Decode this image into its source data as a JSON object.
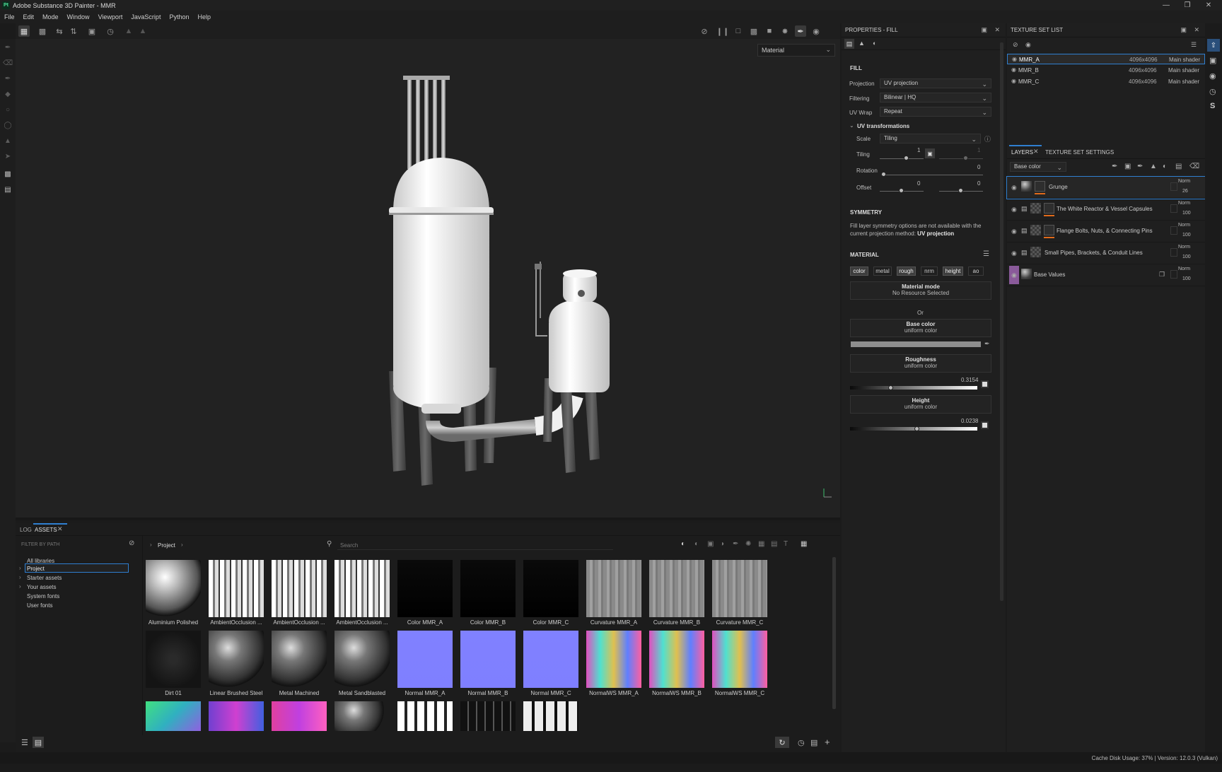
{
  "app": {
    "logo": "Pt",
    "title": "Adobe Substance 3D Painter - MMR",
    "window_controls": [
      "minimize-icon",
      "restore-icon",
      "close-icon"
    ]
  },
  "menu": [
    "File",
    "Edit",
    "Mode",
    "Window",
    "Viewport",
    "JavaScript",
    "Python",
    "Help"
  ],
  "viewport": {
    "mode_select": "Material"
  },
  "properties": {
    "header": "PROPERTIES - FILL",
    "fill_section": "FILL",
    "projection_label": "Projection",
    "projection_value": "UV projection",
    "filtering_label": "Filtering",
    "filtering_value": "Bilinear | HQ",
    "uvwrap_label": "UV Wrap",
    "uvwrap_value": "Repeat",
    "uvtransform_label": "UV transformations",
    "scale_label": "Scale",
    "scale_value": "Tiling",
    "tiling_label": "Tiling",
    "tiling_value": "1",
    "tiling_value2": "1",
    "rotation_label": "Rotation",
    "rotation_value": "0",
    "offset_label": "Offset",
    "offset_value_u": "0",
    "offset_value_v": "0",
    "symmetry_title": "SYMMETRY",
    "symmetry_text": "Fill layer symmetry options are not available with the current projection method:",
    "symmetry_method": "UV projection",
    "material_title": "MATERIAL",
    "channels": [
      {
        "label": "color",
        "on": true
      },
      {
        "label": "metal",
        "on": false
      },
      {
        "label": "rough",
        "on": true
      },
      {
        "label": "nrm",
        "on": false
      },
      {
        "label": "height",
        "on": true
      },
      {
        "label": "ao",
        "on": false
      }
    ],
    "material_mode_title": "Material mode",
    "material_mode_value": "No Resource Selected",
    "or_label": "Or",
    "base_color_title": "Base color",
    "base_color_sub": "uniform color",
    "roughness_title": "Roughness",
    "roughness_sub": "uniform color",
    "roughness_value": "0.3154",
    "height_title": "Height",
    "height_sub": "uniform color",
    "height_value": "0.0238"
  },
  "texture_set_list": {
    "header": "TEXTURE SET LIST",
    "rows": [
      {
        "name": "MMR_A",
        "res": "4096x4096",
        "shader": "Main shader",
        "selected": true
      },
      {
        "name": "MMR_B",
        "res": "4096x4096",
        "shader": "Main shader",
        "selected": false
      },
      {
        "name": "MMR_C",
        "res": "4096x4096",
        "shader": "Main shader",
        "selected": false
      }
    ]
  },
  "layers": {
    "tab_layers": "LAYERS",
    "tab_settings": "TEXTURE SET SETTINGS",
    "channel_select": "Base color",
    "items": [
      {
        "name": "Grunge",
        "blend": "Norm",
        "opacity": "26",
        "selected": true,
        "folder": false
      },
      {
        "name": "The White Reactor & Vessel Capsules",
        "blend": "Norm",
        "opacity": "100",
        "selected": false,
        "folder": true
      },
      {
        "name": "Flange Bolts, Nuts, & Connecting Pins",
        "blend": "Norm",
        "opacity": "100",
        "selected": false,
        "folder": true
      },
      {
        "name": "Small Pipes, Brackets, & Conduit Lines",
        "blend": "Norm",
        "opacity": "100",
        "selected": false,
        "folder": true
      },
      {
        "name": "Base Values",
        "blend": "Norm",
        "opacity": "100",
        "selected": false,
        "folder": false
      }
    ]
  },
  "assets": {
    "tab_log": "LOG",
    "tab_assets": "ASSETS",
    "filter_placeholder": "FILTER BY PATH",
    "breadcrumb": "Project",
    "search_placeholder": "Search",
    "tree": [
      "All libraries",
      "Project",
      "Starter assets",
      "Your assets",
      "System fonts",
      "User fonts"
    ],
    "items": [
      {
        "name": "Aluminium Polished",
        "kind": "sphere-light"
      },
      {
        "name": "AmbientOcclusion ...",
        "kind": "ao"
      },
      {
        "name": "AmbientOcclusion ...",
        "kind": "ao"
      },
      {
        "name": "AmbientOcclusion ...",
        "kind": "ao"
      },
      {
        "name": "Color MMR_A",
        "kind": "black"
      },
      {
        "name": "Color MMR_B",
        "kind": "black"
      },
      {
        "name": "Color MMR_C",
        "kind": "black"
      },
      {
        "name": "Curvature MMR_A",
        "kind": "grey"
      },
      {
        "name": "Curvature MMR_B",
        "kind": "grey"
      },
      {
        "name": "Curvature MMR_C",
        "kind": "grey"
      },
      {
        "name": "Dirt 01",
        "kind": "dirt"
      },
      {
        "name": "Linear Brushed Steel",
        "kind": "sphere-dark"
      },
      {
        "name": "Metal Machined",
        "kind": "sphere-dark"
      },
      {
        "name": "Metal Sandblasted",
        "kind": "sphere-dark"
      },
      {
        "name": "Normal MMR_A",
        "kind": "normal"
      },
      {
        "name": "Normal MMR_B",
        "kind": "normal"
      },
      {
        "name": "Normal MMR_C",
        "kind": "normal"
      },
      {
        "name": "NormalWS MMR_A",
        "kind": "normalws"
      },
      {
        "name": "NormalWS MMR_B",
        "kind": "normalws"
      },
      {
        "name": "NormalWS MMR_C",
        "kind": "normalws"
      },
      {
        "name": "",
        "kind": "green"
      },
      {
        "name": "",
        "kind": "purple"
      },
      {
        "name": "",
        "kind": "pink"
      },
      {
        "name": "",
        "kind": "sphere-dark"
      },
      {
        "name": "",
        "kind": "bw"
      },
      {
        "name": "",
        "kind": "darkbw"
      },
      {
        "name": "",
        "kind": "bw2"
      }
    ]
  },
  "status": {
    "text": "Cache Disk Usage:   37% | Version: 12.0.3 (Vulkan)"
  }
}
